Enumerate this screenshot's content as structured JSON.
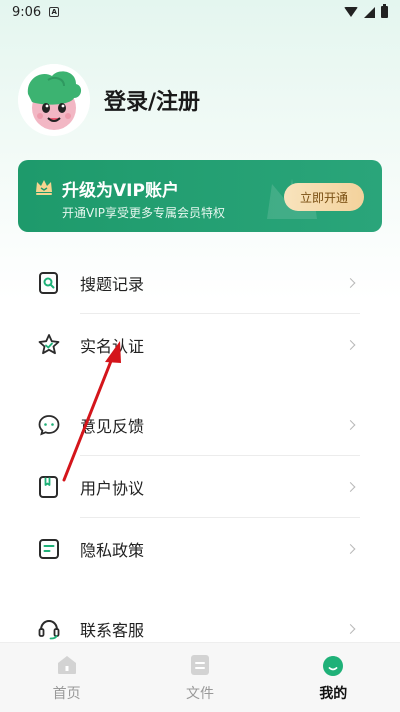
{
  "status_bar": {
    "time": "9:06",
    "notification_badge": "A"
  },
  "profile": {
    "title": "登录/注册"
  },
  "vip": {
    "title": "升级为VIP账户",
    "subtitle": "开通VIP享受更多专属会员特权",
    "button": "立即开通"
  },
  "menu": {
    "items": [
      {
        "label": "搜题记录",
        "icon": "search-record-icon"
      },
      {
        "label": "实名认证",
        "icon": "star-check-icon"
      },
      {
        "label": "意见反馈",
        "icon": "chat-bubble-icon"
      },
      {
        "label": "用户协议",
        "icon": "book-icon"
      },
      {
        "label": "隐私政策",
        "icon": "document-icon"
      },
      {
        "label": "联系客服",
        "icon": "headset-icon"
      }
    ]
  },
  "bottom_nav": {
    "items": [
      {
        "label": "首页",
        "icon": "home-icon",
        "active": false
      },
      {
        "label": "文件",
        "icon": "file-icon",
        "active": false
      },
      {
        "label": "我的",
        "icon": "profile-face-icon",
        "active": true
      }
    ]
  },
  "colors": {
    "brand_green": "#1e9a6b",
    "icon_dark": "#2b2b2b",
    "accent_green": "#1fb178",
    "arrow_red": "#d4151b"
  }
}
